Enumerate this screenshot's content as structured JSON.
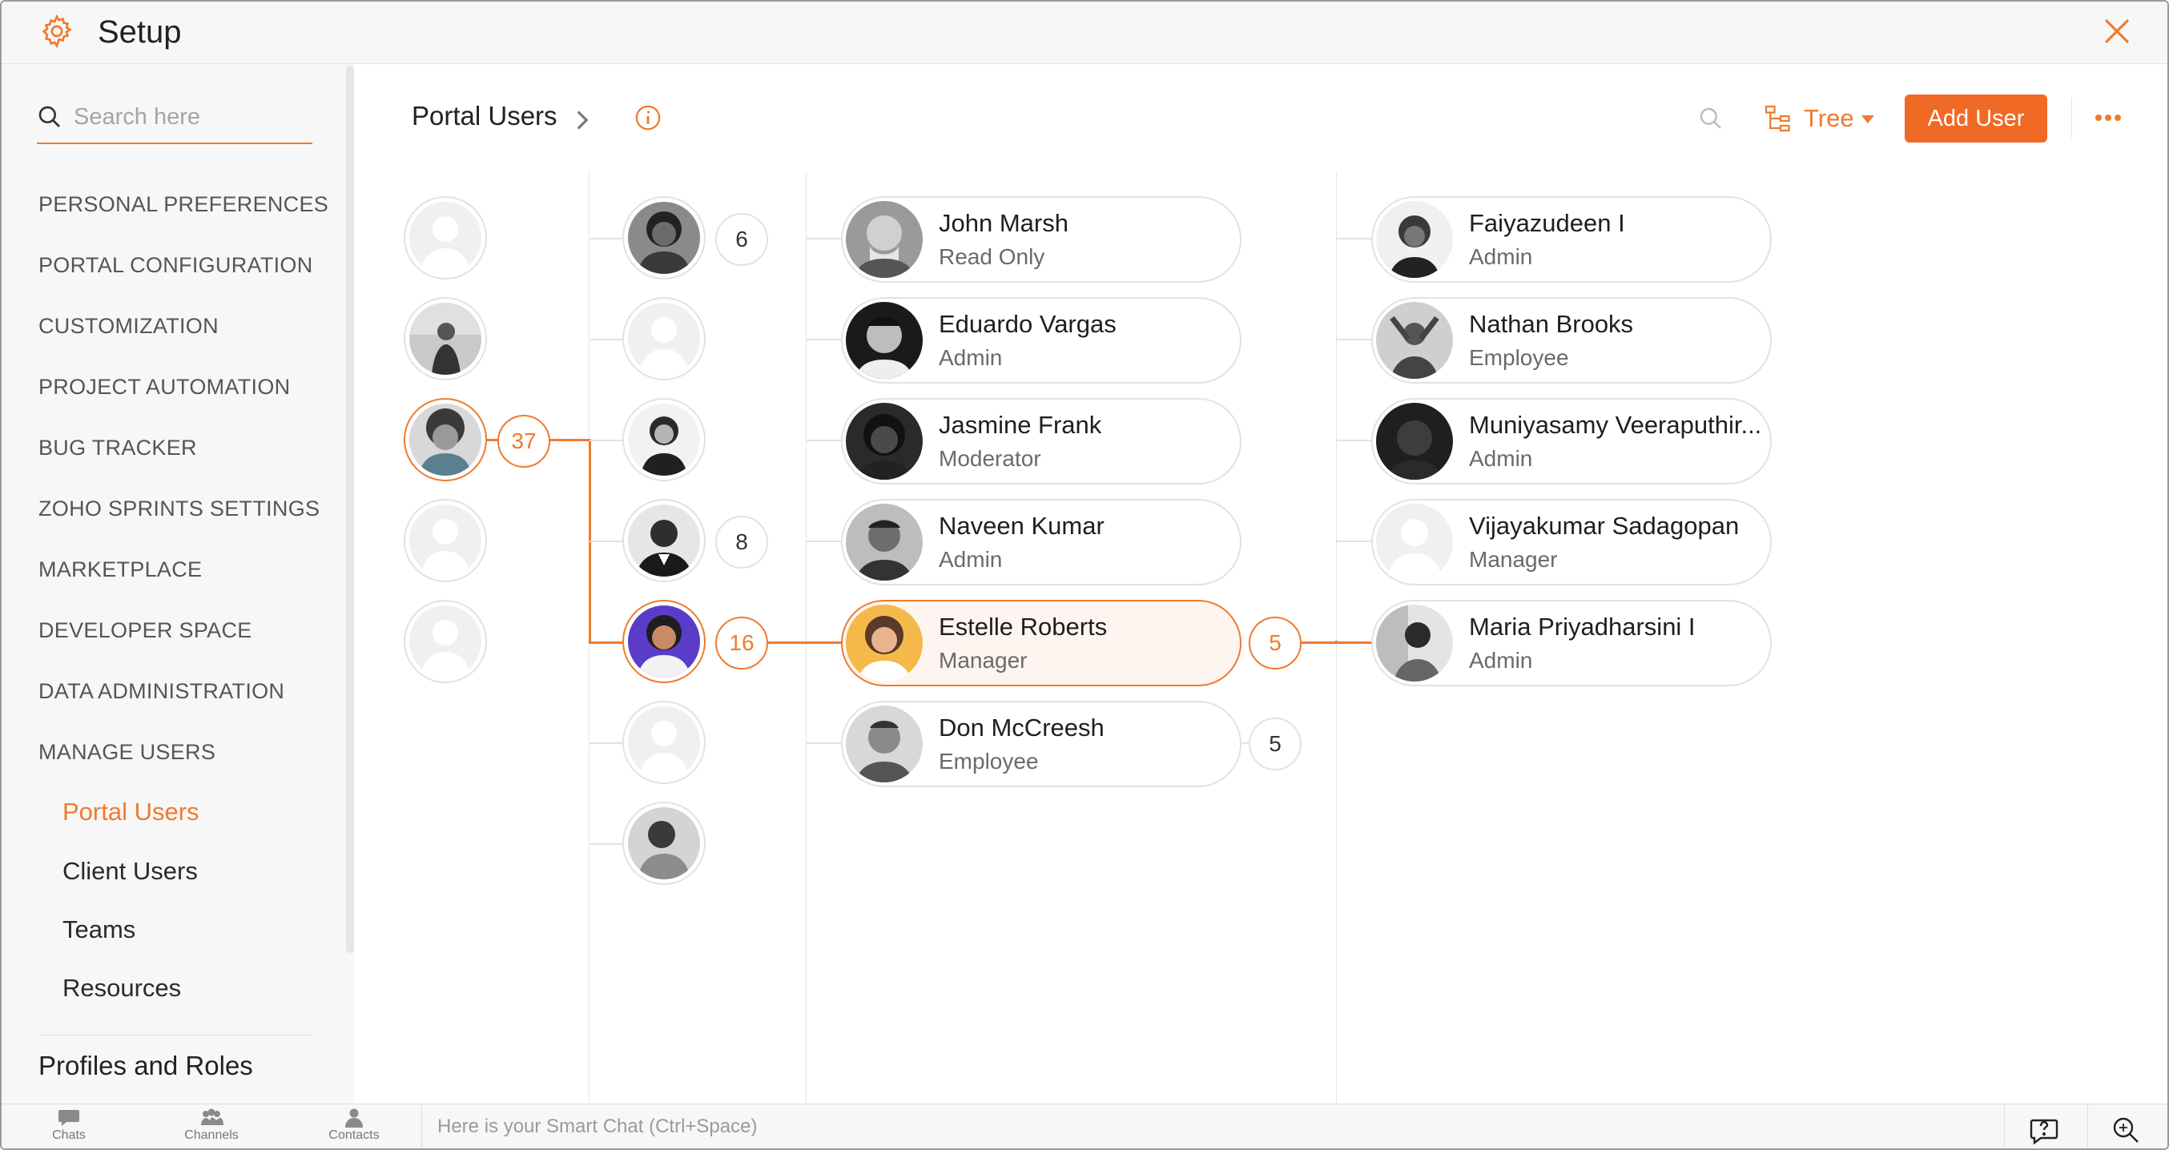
{
  "window": {
    "title": "Setup",
    "close_icon": "close-icon",
    "gear_icon": "gear-icon"
  },
  "sidebar": {
    "search_placeholder": "Search here",
    "items": [
      {
        "label": "PERSONAL PREFERENCES"
      },
      {
        "label": "PORTAL CONFIGURATION"
      },
      {
        "label": "CUSTOMIZATION"
      },
      {
        "label": "PROJECT AUTOMATION"
      },
      {
        "label": "BUG TRACKER"
      },
      {
        "label": "ZOHO SPRINTS SETTINGS"
      },
      {
        "label": "MARKETPLACE"
      },
      {
        "label": "DEVELOPER SPACE"
      },
      {
        "label": "DATA ADMINISTRATION"
      },
      {
        "label": "MANAGE USERS"
      }
    ],
    "sub_items": [
      {
        "label": "Portal Users",
        "active": true
      },
      {
        "label": "Client Users",
        "active": false
      },
      {
        "label": "Teams",
        "active": false
      },
      {
        "label": "Resources",
        "active": false
      }
    ],
    "heading": "Profiles and Roles"
  },
  "header": {
    "title": "Portal Users",
    "view_label": "Tree",
    "add_user_label": "Add User"
  },
  "tree": {
    "col2_counts": [
      "6",
      "8",
      "16"
    ],
    "col1_count": "37",
    "col3_count_active": "5",
    "col3_count_other": "5",
    "col3_users": [
      {
        "name": "John Marsh",
        "role": "Read Only"
      },
      {
        "name": "Eduardo Vargas",
        "role": "Admin"
      },
      {
        "name": "Jasmine Frank",
        "role": "Moderator"
      },
      {
        "name": "Naveen Kumar",
        "role": "Admin"
      },
      {
        "name": "Estelle Roberts",
        "role": "Manager"
      },
      {
        "name": "Don McCreesh",
        "role": "Employee"
      }
    ],
    "col4_users": [
      {
        "name": "Faiyazudeen I",
        "role": "Admin"
      },
      {
        "name": "Nathan Brooks",
        "role": "Employee"
      },
      {
        "name": "Muniyasamy Veeraputhir...",
        "role": "Admin"
      },
      {
        "name": "Vijayakumar Sadagopan",
        "role": "Manager"
      },
      {
        "name": "Maria Priyadharsini I",
        "role": "Admin"
      }
    ]
  },
  "bottombar": {
    "chats": "Chats",
    "channels": "Channels",
    "contacts": "Contacts",
    "smart_chat_placeholder": "Here is your Smart Chat (Ctrl+Space)"
  },
  "colors": {
    "accent": "#f07a2e",
    "button": "#f06a26"
  }
}
